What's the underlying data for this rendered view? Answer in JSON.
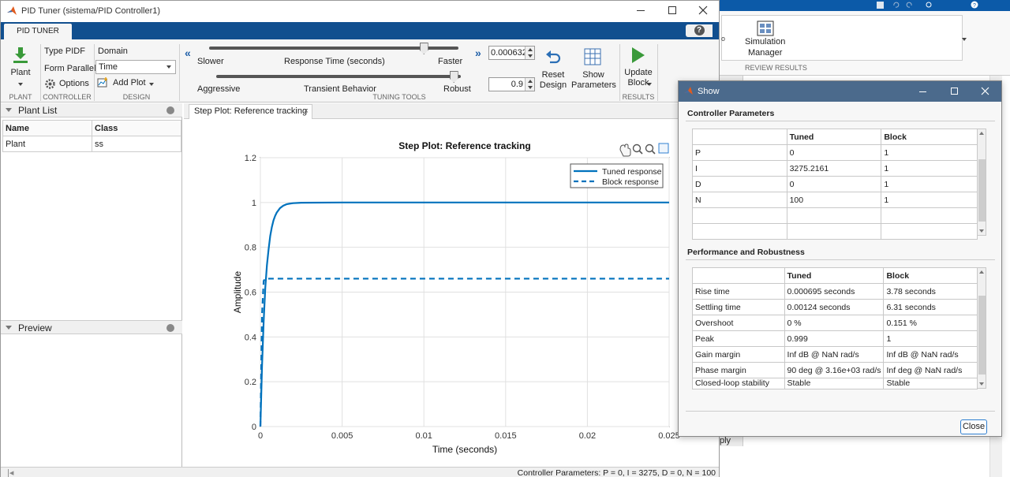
{
  "window": {
    "title": "PID Tuner (sistema/PID Controller1)"
  },
  "tabs": {
    "pid_tuner": "PID TUNER",
    "help": "?"
  },
  "toolstrip": {
    "plant": {
      "button_label": "Plant",
      "section": "PLANT"
    },
    "controller": {
      "type_label": "Type PIDF",
      "form_label": "Form Parallel",
      "options_label": "Options",
      "section": "CONTROLLER"
    },
    "design": {
      "domain_label": "Domain",
      "domain_value": "Time",
      "add_plot_label": "Add Plot",
      "section": "DESIGN"
    },
    "tuning": {
      "slower": "Slower",
      "response_time_label": "Response Time (seconds)",
      "faster": "Faster",
      "aggressive": "Aggressive",
      "transient_label": "Transient Behavior",
      "robust": "Robust",
      "response_time_value": "0.000632",
      "transient_value": "0.9",
      "response_time_position": 0.86,
      "transient_position": 0.97,
      "reset_label_1": "Reset",
      "reset_label_2": "Design",
      "show_label_1": "Show",
      "show_label_2": "Parameters",
      "section": "TUNING TOOLS"
    },
    "results": {
      "update_label_1": "Update",
      "update_label_2": "Block",
      "section": "RESULTS"
    }
  },
  "plant_list": {
    "title": "Plant List",
    "columns": [
      "Name",
      "Class"
    ],
    "rows": [
      [
        "Plant",
        "ss"
      ]
    ]
  },
  "preview": {
    "title": "Preview"
  },
  "plot_tab": {
    "label": "Step Plot: Reference tracking"
  },
  "status": {
    "text": "Controller Parameters: P = 0, I = 3275, D = 0, N = 100"
  },
  "background_window": {
    "simulation_manager_1": "Simulation",
    "simulation_manager_2": "Manager",
    "review_results": "REVIEW RESULTS",
    "apply_fragment": "ply",
    "fragment_char": "o"
  },
  "show_dialog": {
    "title": "Show",
    "controller_section": "Controller Parameters",
    "controller_columns": [
      "",
      "Tuned",
      "Block"
    ],
    "controller_rows": [
      [
        "P",
        "0",
        "1"
      ],
      [
        "I",
        "3275.2161",
        "1"
      ],
      [
        "D",
        "0",
        "1"
      ],
      [
        "N",
        "100",
        "1"
      ],
      [
        "",
        "",
        ""
      ],
      [
        "",
        "",
        ""
      ]
    ],
    "performance_section": "Performance and Robustness",
    "performance_columns": [
      "",
      "Tuned",
      "Block"
    ],
    "performance_rows": [
      [
        "Rise time",
        "0.000695 seconds",
        "3.78 seconds"
      ],
      [
        "Settling time",
        "0.00124 seconds",
        "6.31 seconds"
      ],
      [
        "Overshoot",
        "0 %",
        "0.151 %"
      ],
      [
        "Peak",
        "0.999",
        "1"
      ],
      [
        "Gain margin",
        "Inf dB @ NaN rad/s",
        "Inf dB @ NaN rad/s"
      ],
      [
        "Phase margin",
        "90 deg @ 3.16e+03 rad/s",
        "Inf deg @ NaN rad/s"
      ],
      [
        "Closed-loop stability",
        "Stable",
        "Stable"
      ]
    ],
    "close_label": "Close"
  },
  "colors": {
    "tabbar": "#114f8f",
    "dialog_title": "#4b6a8c",
    "plot_line": "#0072bd"
  },
  "chart_data": {
    "type": "line",
    "title": "Step Plot: Reference tracking",
    "xlabel": "Time (seconds)",
    "ylabel": "Amplitude",
    "xlim": [
      0,
      0.025
    ],
    "ylim": [
      0,
      1.2
    ],
    "xticks": [
      0,
      0.005,
      0.01,
      0.015,
      0.02,
      0.025
    ],
    "xtick_labels": [
      "0",
      "0.005",
      "0.01",
      "0.015",
      "0.02",
      "0.025"
    ],
    "yticks": [
      0,
      0.2,
      0.4,
      0.6,
      0.8,
      1,
      1.2
    ],
    "ytick_labels": [
      "0",
      "0.2",
      "0.4",
      "0.6",
      "0.8",
      "1",
      "1.2"
    ],
    "grid": true,
    "legend_position": "top-right",
    "series": [
      {
        "name": "Tuned response",
        "style": "solid",
        "x": [
          0,
          0.0001,
          0.0002,
          0.0003,
          0.0004,
          0.0005,
          0.0006,
          0.0007,
          0.0008,
          0.0009,
          0.001,
          0.0012,
          0.0014,
          0.0016,
          0.0018,
          0.002,
          0.0025,
          0.005,
          0.01,
          0.015,
          0.02,
          0.025
        ],
        "y": [
          0,
          0.27,
          0.47,
          0.62,
          0.72,
          0.79,
          0.85,
          0.89,
          0.92,
          0.94,
          0.955,
          0.975,
          0.986,
          0.992,
          0.995,
          0.997,
          0.999,
          1.0,
          1.0,
          1.0,
          1.0,
          1.0
        ]
      },
      {
        "name": "Block response",
        "style": "dashed",
        "x": [
          0,
          0.0001,
          0.0002,
          0.0003,
          0.005,
          0.01,
          0.015,
          0.02,
          0.025
        ],
        "y": [
          0,
          0.5,
          0.65,
          0.66,
          0.66,
          0.66,
          0.66,
          0.66,
          0.66
        ]
      }
    ]
  }
}
